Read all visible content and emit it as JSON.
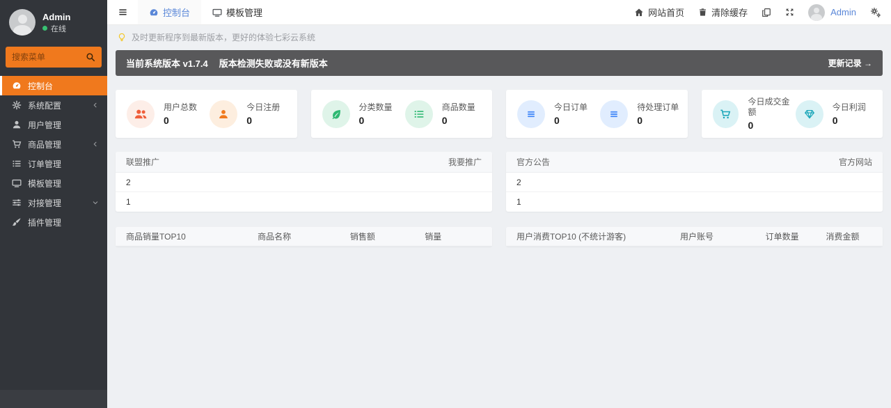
{
  "colors": {
    "accent_orange": "#f0791d",
    "link_blue": "#5a87d8",
    "banner_bg": "#58585a",
    "sidebar_bg": "#32353a",
    "page_bg": "#eef0f3"
  },
  "sidebar": {
    "user_name": "Admin",
    "user_status": "在线",
    "search_placeholder": "搜索菜单",
    "items": [
      {
        "label": "控制台"
      },
      {
        "label": "系统配置"
      },
      {
        "label": "用户管理"
      },
      {
        "label": "商品管理"
      },
      {
        "label": "订单管理"
      },
      {
        "label": "模板管理"
      },
      {
        "label": "对接管理"
      },
      {
        "label": "插件管理"
      }
    ]
  },
  "topbar": {
    "tabs": [
      {
        "label": "控制台"
      },
      {
        "label": "模板管理"
      }
    ],
    "home_label": "网站首页",
    "clear_cache_label": "清除缓存",
    "user_name": "Admin"
  },
  "notice": {
    "text": "及时更新程序到最新版本，更好的体验七彩云系统"
  },
  "version_banner": {
    "version_text": "当前系统版本 v1.7.4",
    "status_text": "版本检测失败或没有新版本",
    "link_label": "更新记录 →"
  },
  "stat_cards": [
    {
      "stats": [
        {
          "label": "用户总数",
          "value": "0",
          "icon": "users-icon",
          "color": "#ef5e3a",
          "bg": "#fdeee8"
        },
        {
          "label": "今日注册",
          "value": "0",
          "icon": "user-icon",
          "color": "#f0791d",
          "bg": "#fdeedf"
        }
      ]
    },
    {
      "stats": [
        {
          "label": "分类数量",
          "value": "0",
          "icon": "leaf-icon",
          "color": "#2eb872",
          "bg": "#dff4e9"
        },
        {
          "label": "商品数量",
          "value": "0",
          "icon": "list-icon",
          "color": "#2eb872",
          "bg": "#dff4e9"
        }
      ]
    },
    {
      "stats": [
        {
          "label": "今日订单",
          "value": "0",
          "icon": "bars-icon",
          "color": "#4a8df8",
          "bg": "#e1edfe"
        },
        {
          "label": "待处理订单",
          "value": "0",
          "icon": "bars-icon",
          "color": "#4a8df8",
          "bg": "#e1edfe"
        }
      ]
    },
    {
      "stats": [
        {
          "label": "今日成交金额",
          "value": "0",
          "icon": "cart-icon",
          "color": "#18a5b8",
          "bg": "#daf2f5"
        },
        {
          "label": "今日利润",
          "value": "0",
          "icon": "gem-icon",
          "color": "#18a5b8",
          "bg": "#daf2f5"
        }
      ]
    }
  ],
  "panels": [
    {
      "title": "联盟推广",
      "link_label": "我要推广",
      "rows": [
        "2",
        "1"
      ]
    },
    {
      "title": "官方公告",
      "link_label": "官方网站",
      "rows": [
        "2",
        "1"
      ]
    }
  ],
  "tables": [
    {
      "title": "商品销量TOP10",
      "columns": [
        "商品名称",
        "销售额",
        "销量"
      ]
    },
    {
      "title": "用户消费TOP10 (不统计游客)",
      "columns": [
        "用户账号",
        "订单数量",
        "消费金额"
      ]
    }
  ]
}
